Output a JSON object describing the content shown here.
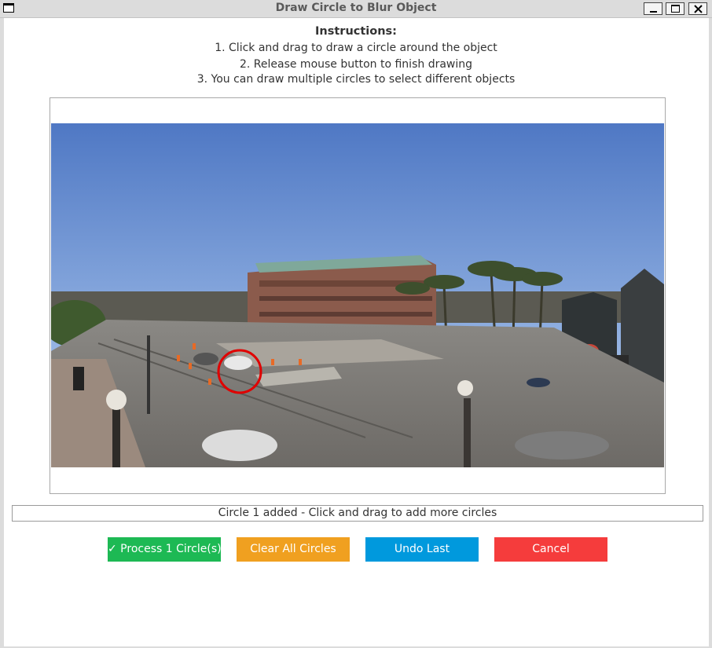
{
  "window": {
    "title": "Draw Circle to Blur Object"
  },
  "instructions": {
    "heading": "Instructions:",
    "steps": [
      "1. Click and drag to draw a circle around the object",
      "2. Release mouse button to finish drawing",
      "3. You can draw multiple circles to select different objects"
    ]
  },
  "canvas": {
    "photo_description_icon": "street-photo",
    "circle_color": "#e00000"
  },
  "status": {
    "text": "Circle 1 added - Click and drag to add more circles"
  },
  "buttons": {
    "process_label": "✓ Process 1 Circle(s)",
    "clear_label": "Clear All Circles",
    "undo_label": "Undo Last",
    "cancel_label": "Cancel"
  },
  "colors": {
    "process": "#1db954",
    "clear": "#f0a020",
    "undo": "#0099dd",
    "cancel": "#f53c3c"
  }
}
